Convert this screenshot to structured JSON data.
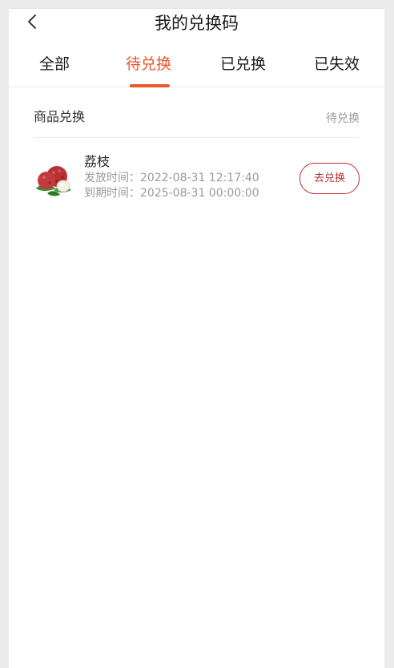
{
  "header": {
    "title": "我的兑换码",
    "back_icon": "chevron-left-icon"
  },
  "tabs": [
    {
      "label": "全部",
      "active": false
    },
    {
      "label": "待兑换",
      "active": true
    },
    {
      "label": "已兑换",
      "active": false
    },
    {
      "label": "已失效",
      "active": false
    }
  ],
  "colors": {
    "accent": "#e8572a",
    "button": "#b8322f",
    "muted_text": "#9a9a9a"
  },
  "card": {
    "type_label": "商品兑换",
    "status_label": "待兑换",
    "product": {
      "name": "荔枝",
      "image_icon": "lychee-image"
    },
    "issue_time": "发放时间：2022-08-31 12:17:40",
    "expire_time": "到期时间：2025-08-31 00:00:00",
    "action_label": "去兑换"
  }
}
